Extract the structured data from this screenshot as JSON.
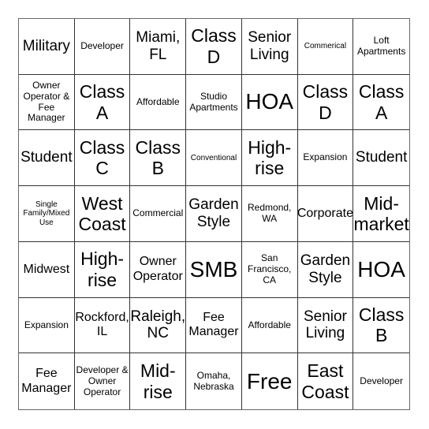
{
  "board": {
    "size": 7,
    "cells": [
      [
        {
          "text": "Military",
          "size": "lg"
        },
        {
          "text": "Developer",
          "size": "sm"
        },
        {
          "text": "Miami, FL",
          "size": "lg"
        },
        {
          "text": "Class D",
          "size": "xl"
        },
        {
          "text": "Senior Living",
          "size": "lg"
        },
        {
          "text": "Commerical",
          "size": "xs"
        },
        {
          "text": "Loft Apartments",
          "size": "sm"
        }
      ],
      [
        {
          "text": "Owner Operator & Fee Manager",
          "size": "sm"
        },
        {
          "text": "Class A",
          "size": "xl"
        },
        {
          "text": "Affordable",
          "size": "sm"
        },
        {
          "text": "Studio Apartments",
          "size": "sm"
        },
        {
          "text": "HOA",
          "size": "xxl"
        },
        {
          "text": "Class D",
          "size": "xl"
        },
        {
          "text": "Class A",
          "size": "xl"
        }
      ],
      [
        {
          "text": "Student",
          "size": "lg"
        },
        {
          "text": "Class C",
          "size": "xl"
        },
        {
          "text": "Class B",
          "size": "xl"
        },
        {
          "text": "Conventional",
          "size": "xs"
        },
        {
          "text": "High-rise",
          "size": "xl"
        },
        {
          "text": "Expansion",
          "size": "sm"
        },
        {
          "text": "Student",
          "size": "lg"
        }
      ],
      [
        {
          "text": "Single Family/Mixed Use",
          "size": "xs"
        },
        {
          "text": "West Coast",
          "size": "xl"
        },
        {
          "text": "Commercial",
          "size": "sm"
        },
        {
          "text": "Garden Style",
          "size": "lg"
        },
        {
          "text": "Redmond, WA",
          "size": "sm"
        },
        {
          "text": "Corporate",
          "size": "md"
        },
        {
          "text": "Mid-market",
          "size": "xl"
        }
      ],
      [
        {
          "text": "Midwest",
          "size": "md"
        },
        {
          "text": "High-rise",
          "size": "xl"
        },
        {
          "text": "Owner Operator",
          "size": "md"
        },
        {
          "text": "SMB",
          "size": "xxl"
        },
        {
          "text": "San Francisco, CA",
          "size": "sm"
        },
        {
          "text": "Garden Style",
          "size": "lg"
        },
        {
          "text": "HOA",
          "size": "xxl"
        }
      ],
      [
        {
          "text": "Expansion",
          "size": "sm"
        },
        {
          "text": "Rockford, IL",
          "size": "md"
        },
        {
          "text": "Raleigh, NC",
          "size": "lg"
        },
        {
          "text": "Fee Manager",
          "size": "md"
        },
        {
          "text": "Affordable",
          "size": "sm"
        },
        {
          "text": "Senior Living",
          "size": "lg"
        },
        {
          "text": "Class B",
          "size": "xl"
        }
      ],
      [
        {
          "text": "Fee Manager",
          "size": "md"
        },
        {
          "text": "Developer & Owner Operator",
          "size": "sm"
        },
        {
          "text": "Mid-rise",
          "size": "xl"
        },
        {
          "text": "Omaha, Nebraska",
          "size": "sm"
        },
        {
          "text": "Free",
          "size": "xxl"
        },
        {
          "text": "East Coast",
          "size": "xl"
        },
        {
          "text": "Developer",
          "size": "sm"
        }
      ]
    ]
  },
  "colors": {
    "grid_line": "#333333",
    "outer_border": "#666666",
    "background": "#ffffff",
    "text": "#000000"
  }
}
